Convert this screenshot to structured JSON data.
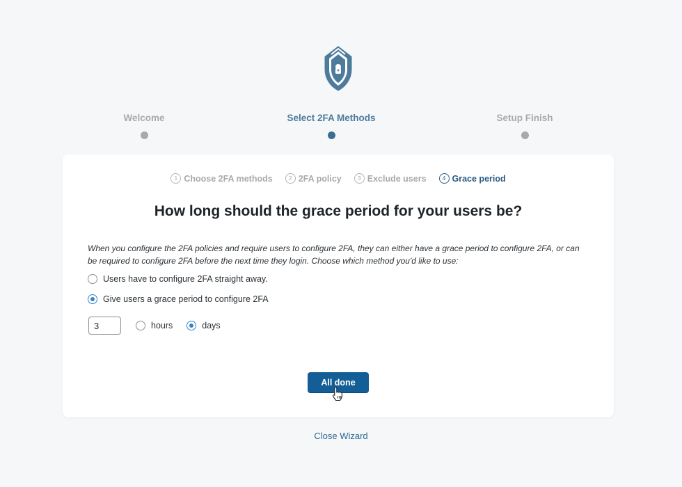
{
  "logo": {
    "icon": "shield-lock-icon",
    "color": "#4d7b9c"
  },
  "wizard_steps": [
    {
      "label": "Welcome",
      "active": false
    },
    {
      "label": "Select 2FA Methods",
      "active": true
    },
    {
      "label": "Setup Finish",
      "active": false
    }
  ],
  "sub_steps": [
    {
      "num": "1",
      "label": "Choose 2FA methods",
      "active": false
    },
    {
      "num": "2",
      "label": "2FA policy",
      "active": false
    },
    {
      "num": "3",
      "label": "Exclude users",
      "active": false
    },
    {
      "num": "4",
      "label": "Grace period",
      "active": true
    }
  ],
  "heading": "How long should the grace period for your users be?",
  "description": "When you configure the 2FA policies and require users to configure 2FA, they can either have a grace period to configure 2FA, or can be required to configure 2FA before the next time they login. Choose which method you'd like to use:",
  "options": [
    {
      "label": "Users have to configure 2FA straight away.",
      "checked": false
    },
    {
      "label": "Give users a grace period to configure 2FA",
      "checked": true
    }
  ],
  "grace_period": {
    "value": "3",
    "units": [
      {
        "label": "hours",
        "checked": false
      },
      {
        "label": "days",
        "checked": true
      }
    ]
  },
  "done_button": "All done",
  "close_link": "Close Wizard",
  "colors": {
    "accent": "#135e96",
    "active_step": "#4d7b9c",
    "inactive": "#a7aaad"
  }
}
